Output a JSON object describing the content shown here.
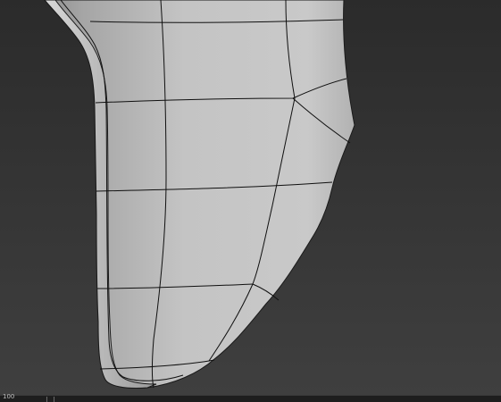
{
  "viewport": {
    "background_top": "#2c2c2c",
    "background_bottom": "#3d3d3d",
    "mesh_color": "#b9b9b9",
    "wire_color": "#111111"
  },
  "timeline": {
    "frame_label": "100"
  }
}
